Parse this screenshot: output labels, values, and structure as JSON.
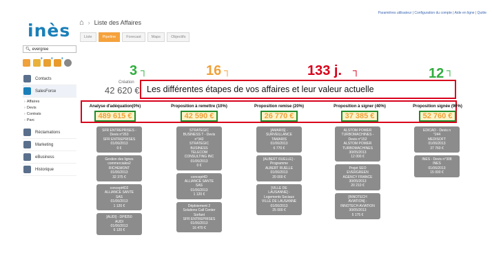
{
  "header": {
    "toplinks": "Paramètres utilisateur | Configuration du compte | Aide en ligne | Quitte",
    "logo": "inès",
    "page_title": "Liste des Affaires"
  },
  "search": {
    "value": "evergree"
  },
  "sidebar": {
    "items": [
      {
        "label": "Contacts",
        "icon": "contacts-icon",
        "color": "#5a6f8c"
      },
      {
        "label": "SalesForce",
        "icon": "salesforce-icon",
        "color": "#1a7fb8"
      }
    ],
    "sub": [
      "Affaires",
      "Devis",
      "Contrats",
      "Parc"
    ],
    "items2": [
      {
        "label": "Réclamations",
        "icon": "claims-icon",
        "color": "#5a6f8c"
      },
      {
        "label": "Marketing",
        "icon": "marketing-icon",
        "color": "#5a6f8c"
      },
      {
        "label": "eBusiness",
        "icon": "ebusiness-icon",
        "color": "#5a6f8c"
      },
      {
        "label": "Historique",
        "icon": "history-icon",
        "color": "#5a6f8c"
      }
    ]
  },
  "tabs": [
    "Liste",
    "Pipeline",
    "Forecast",
    "Maps",
    "Objectifs"
  ],
  "active_tab": "Pipeline",
  "stats": {
    "creation_label": "Création",
    "creation_value": "42 620 €",
    "n1": "3",
    "n2": "16",
    "n3": "133 j.",
    "n4": "12"
  },
  "callout": "Les différentes étapes de vos affaires et leur valeur actuelle",
  "stages": [
    {
      "name": "Analyse d'adéquation(0%)",
      "value": "489 615 €",
      "cards": [
        "SFR ENTREPRISES -\nDevis n°263\nSFR ENTREPRISES\n01/06/2013\n0 €",
        "Gestion des lignes\ncommerciales2\nRICHEMONT\n01/06/2013\n32 375 €",
        "concept4D2\nALLIANCE SANTE\nSAS\n01/06/2013\n1 120 €",
        "[AUDI] - DP8250\nAUDI\n01/06/2013\n6 120 €"
      ]
    },
    {
      "name": "Proposition à remettre (10%)",
      "value": "42 590 €",
      "cards": [
        "STRATEGIC\nBUSINESS T - Devis\nn°342\nSTRATEGIC\nBUSINESS\nTELECOM\nCONSULTING INC\n01/06/2013\n0 €",
        "concept4D\nALLIANCE SANTE\nSAS\n01/06/2013\n1 120 €",
        "Déploiement 2\nSolutions Call Center\nSorfant\nSFR ENTREPRISES\n01/06/2013\n16 470 €"
      ]
    },
    {
      "name": "Proposition remise (20%)",
      "value": "26 770 €",
      "cards": [
        "[AMARIS] -\nSURVEILLANCE\nTAMARIS\n01/06/2013\n6 770 €",
        "[ALBERT RUELLE] -\nProgramme\nALBERT RUELLE\n01/06/2013\n20 000 €",
        "[VILLE DE\nLAUSANNE] -\nLogements Sociaux\nVILLE DE LAUSANNE\n01/06/2013\n25 000 €"
      ]
    },
    {
      "name": "Proposition à signer (40%)",
      "value": "37 385 €",
      "cards": [
        "ALSTOM POWER\nTURBOMACHINES -\nDevis n°152\nALSTOM POWER\nTURBOMACHINES\n30/05/2013\n12 000 €",
        "Projet SEO\nEVERGREEN\nAGENCY FRANCE\n30/05/2013\n20 210 €",
        "[INNOTECH\nAVIATION] -\nINNOTECH AVIATION\n30/05/2013\n5 175 €"
      ]
    },
    {
      "name": "Proposition signée (90%)",
      "value": "52 760 €",
      "cards": [
        "EDICAD - Devis n\n°244\nMEDISOFT\n01/06/2013\n37 760 €",
        "INES - Devis n°308\nINES\n01/06/2013\n15 000 €"
      ]
    }
  ],
  "colors": {
    "green": "#2fae3e",
    "orange": "#f0a13a",
    "red": "#d8001a"
  }
}
